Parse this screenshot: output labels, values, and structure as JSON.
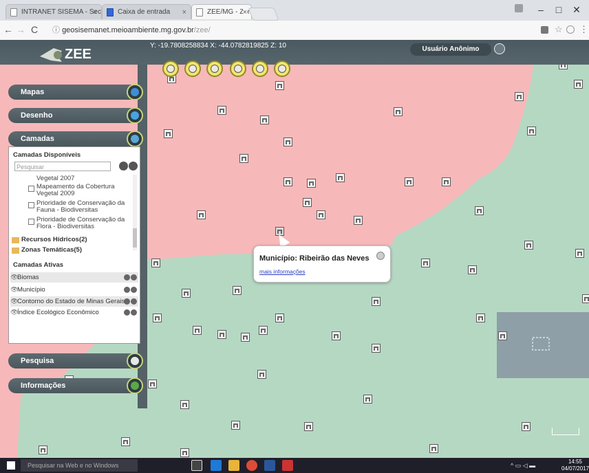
{
  "browser": {
    "tabs": [
      {
        "label": "INTRANET SISEMA - Sec"
      },
      {
        "label": "Caixa de entrada"
      },
      {
        "label": "ZEE/MG - Zoneamento E"
      }
    ],
    "url_host": "geosisemanet.meioambiente.mg.gov.br",
    "url_path": "/zee/",
    "url_prefix": "ⓘ"
  },
  "app": {
    "logo_text": "ZEE",
    "coordinates": "Y: -19.7808258834  X: -44.0782819825  Z: 10",
    "user_label": "Usuário Anônimo"
  },
  "sidebar": {
    "mapas": "Mapas",
    "desenho": "Desenho",
    "camadas": "Camadas",
    "pesquisa": "Pesquisa",
    "informacoes": "Informações"
  },
  "layers": {
    "available_title": "Camadas Disponíveis",
    "search_placeholder": "Pesquisar",
    "items": [
      {
        "label": "Vegetal 2007"
      },
      {
        "label": "Mapeamento da Cobertura Vegetal 2009"
      },
      {
        "label": "Prioridade de Conservação da Fauna - Biodiversitas"
      },
      {
        "label": "Prioridade de Conservação da Flora - Biodiversitas"
      }
    ],
    "groups": [
      {
        "label": "Recursos Hídricos(2)"
      },
      {
        "label": "Zonas Temáticas(5)"
      }
    ],
    "active_title": "Camadas Ativas",
    "active": [
      {
        "label": "Biomas"
      },
      {
        "label": "Município"
      },
      {
        "label": "Contorno do Estado de Minas Gerais"
      },
      {
        "label": "Índice Ecológico Econômico"
      }
    ]
  },
  "popup": {
    "title": "Município: Ribeirão das Neves",
    "link": "mais informações"
  },
  "taskbar": {
    "search": "Pesquisar na Web e no Windows",
    "time": "14:55",
    "date": "04/07/2017"
  },
  "colors": {
    "zone_pink": "#f7b8b9",
    "zone_green": "#b5d8c3",
    "panel_dark": "#4d5a60",
    "selection_gray": "#8e9fa8"
  }
}
